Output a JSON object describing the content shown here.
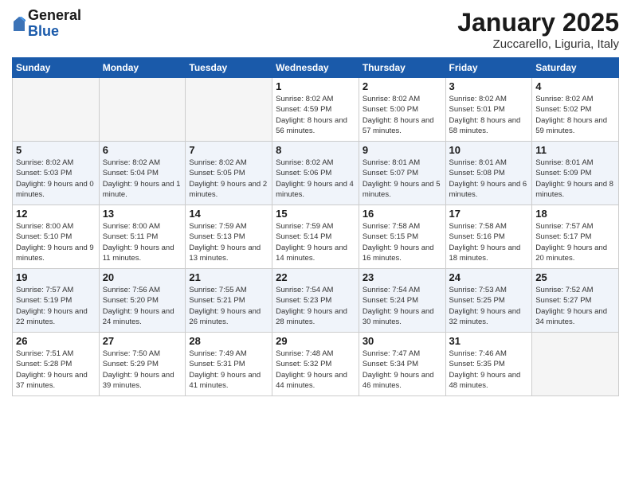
{
  "header": {
    "logo_general": "General",
    "logo_blue": "Blue",
    "month_title": "January 2025",
    "location": "Zuccarello, Liguria, Italy"
  },
  "days_of_week": [
    "Sunday",
    "Monday",
    "Tuesday",
    "Wednesday",
    "Thursday",
    "Friday",
    "Saturday"
  ],
  "weeks": [
    [
      {
        "day": "",
        "info": ""
      },
      {
        "day": "",
        "info": ""
      },
      {
        "day": "",
        "info": ""
      },
      {
        "day": "1",
        "info": "Sunrise: 8:02 AM\nSunset: 4:59 PM\nDaylight: 8 hours and 56 minutes."
      },
      {
        "day": "2",
        "info": "Sunrise: 8:02 AM\nSunset: 5:00 PM\nDaylight: 8 hours and 57 minutes."
      },
      {
        "day": "3",
        "info": "Sunrise: 8:02 AM\nSunset: 5:01 PM\nDaylight: 8 hours and 58 minutes."
      },
      {
        "day": "4",
        "info": "Sunrise: 8:02 AM\nSunset: 5:02 PM\nDaylight: 8 hours and 59 minutes."
      }
    ],
    [
      {
        "day": "5",
        "info": "Sunrise: 8:02 AM\nSunset: 5:03 PM\nDaylight: 9 hours and 0 minutes."
      },
      {
        "day": "6",
        "info": "Sunrise: 8:02 AM\nSunset: 5:04 PM\nDaylight: 9 hours and 1 minute."
      },
      {
        "day": "7",
        "info": "Sunrise: 8:02 AM\nSunset: 5:05 PM\nDaylight: 9 hours and 2 minutes."
      },
      {
        "day": "8",
        "info": "Sunrise: 8:02 AM\nSunset: 5:06 PM\nDaylight: 9 hours and 4 minutes."
      },
      {
        "day": "9",
        "info": "Sunrise: 8:01 AM\nSunset: 5:07 PM\nDaylight: 9 hours and 5 minutes."
      },
      {
        "day": "10",
        "info": "Sunrise: 8:01 AM\nSunset: 5:08 PM\nDaylight: 9 hours and 6 minutes."
      },
      {
        "day": "11",
        "info": "Sunrise: 8:01 AM\nSunset: 5:09 PM\nDaylight: 9 hours and 8 minutes."
      }
    ],
    [
      {
        "day": "12",
        "info": "Sunrise: 8:00 AM\nSunset: 5:10 PM\nDaylight: 9 hours and 9 minutes."
      },
      {
        "day": "13",
        "info": "Sunrise: 8:00 AM\nSunset: 5:11 PM\nDaylight: 9 hours and 11 minutes."
      },
      {
        "day": "14",
        "info": "Sunrise: 7:59 AM\nSunset: 5:13 PM\nDaylight: 9 hours and 13 minutes."
      },
      {
        "day": "15",
        "info": "Sunrise: 7:59 AM\nSunset: 5:14 PM\nDaylight: 9 hours and 14 minutes."
      },
      {
        "day": "16",
        "info": "Sunrise: 7:58 AM\nSunset: 5:15 PM\nDaylight: 9 hours and 16 minutes."
      },
      {
        "day": "17",
        "info": "Sunrise: 7:58 AM\nSunset: 5:16 PM\nDaylight: 9 hours and 18 minutes."
      },
      {
        "day": "18",
        "info": "Sunrise: 7:57 AM\nSunset: 5:17 PM\nDaylight: 9 hours and 20 minutes."
      }
    ],
    [
      {
        "day": "19",
        "info": "Sunrise: 7:57 AM\nSunset: 5:19 PM\nDaylight: 9 hours and 22 minutes."
      },
      {
        "day": "20",
        "info": "Sunrise: 7:56 AM\nSunset: 5:20 PM\nDaylight: 9 hours and 24 minutes."
      },
      {
        "day": "21",
        "info": "Sunrise: 7:55 AM\nSunset: 5:21 PM\nDaylight: 9 hours and 26 minutes."
      },
      {
        "day": "22",
        "info": "Sunrise: 7:54 AM\nSunset: 5:23 PM\nDaylight: 9 hours and 28 minutes."
      },
      {
        "day": "23",
        "info": "Sunrise: 7:54 AM\nSunset: 5:24 PM\nDaylight: 9 hours and 30 minutes."
      },
      {
        "day": "24",
        "info": "Sunrise: 7:53 AM\nSunset: 5:25 PM\nDaylight: 9 hours and 32 minutes."
      },
      {
        "day": "25",
        "info": "Sunrise: 7:52 AM\nSunset: 5:27 PM\nDaylight: 9 hours and 34 minutes."
      }
    ],
    [
      {
        "day": "26",
        "info": "Sunrise: 7:51 AM\nSunset: 5:28 PM\nDaylight: 9 hours and 37 minutes."
      },
      {
        "day": "27",
        "info": "Sunrise: 7:50 AM\nSunset: 5:29 PM\nDaylight: 9 hours and 39 minutes."
      },
      {
        "day": "28",
        "info": "Sunrise: 7:49 AM\nSunset: 5:31 PM\nDaylight: 9 hours and 41 minutes."
      },
      {
        "day": "29",
        "info": "Sunrise: 7:48 AM\nSunset: 5:32 PM\nDaylight: 9 hours and 44 minutes."
      },
      {
        "day": "30",
        "info": "Sunrise: 7:47 AM\nSunset: 5:34 PM\nDaylight: 9 hours and 46 minutes."
      },
      {
        "day": "31",
        "info": "Sunrise: 7:46 AM\nSunset: 5:35 PM\nDaylight: 9 hours and 48 minutes."
      },
      {
        "day": "",
        "info": ""
      }
    ]
  ]
}
